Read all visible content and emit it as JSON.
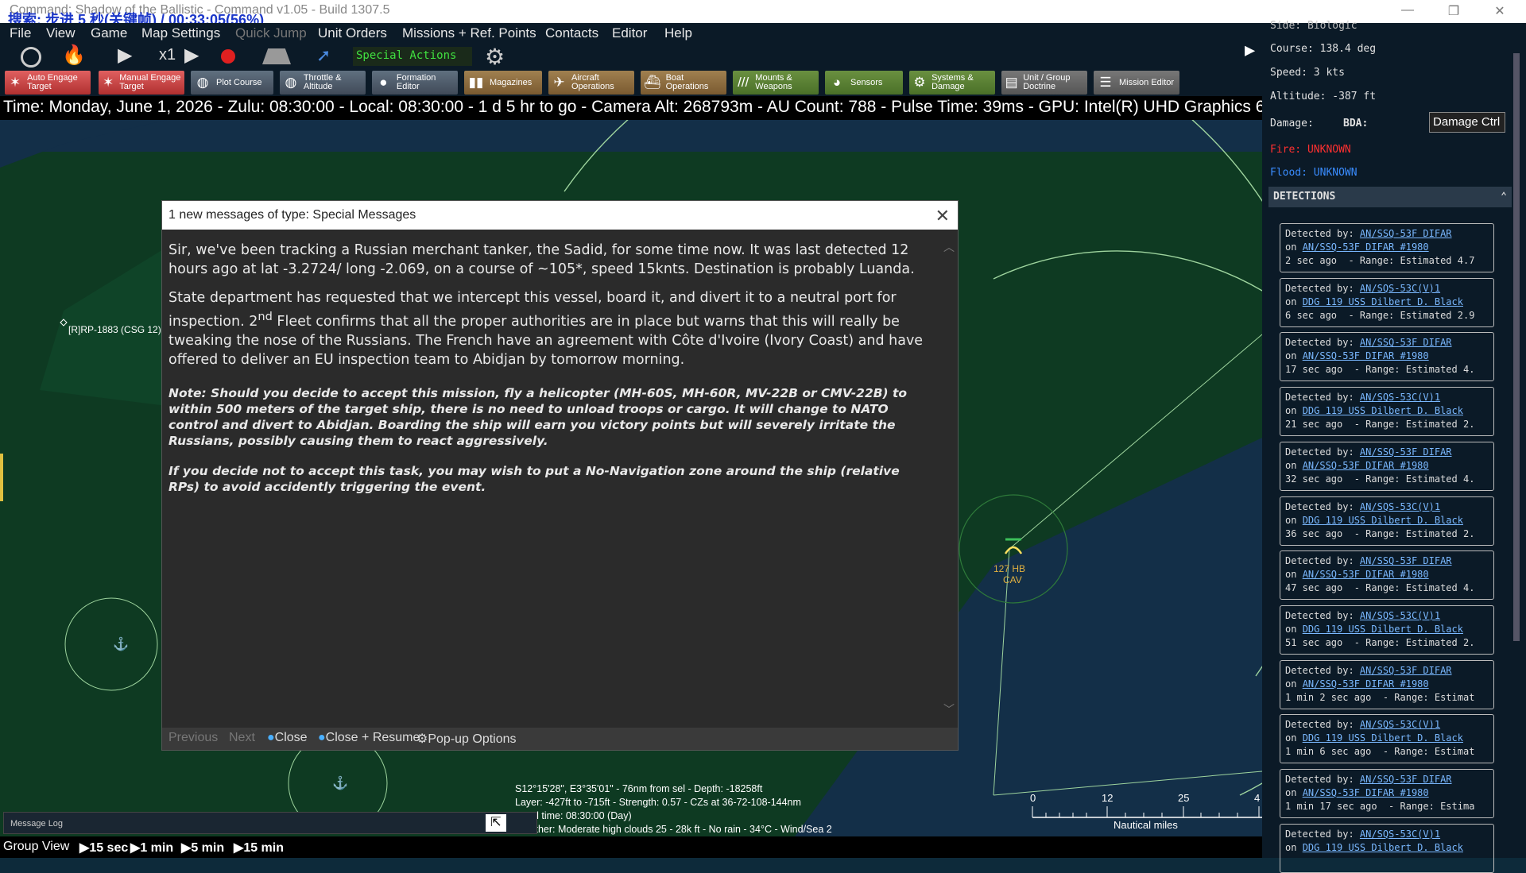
{
  "window": {
    "title": "Command: Shadow of the Ballistic - Command v1.05 - Build 1307.5",
    "overlay": "搜索: 步进 5 秒(关键帧) / 00:33:05(56%)",
    "minimize": "—",
    "restore": "❐",
    "close": "✕"
  },
  "menu": [
    "File",
    "View",
    "Game",
    "Map Settings",
    "Quick Jump",
    "Unit Orders",
    "Missions + Ref. Points",
    "Contacts",
    "Editor",
    "Help"
  ],
  "toolbar1": {
    "speed": "x1",
    "special_actions": "Special Actions"
  },
  "toolbar2": [
    "Auto Engage Target",
    "Manual Engage Target",
    "Plot Course",
    "Throttle & Altitude",
    "Formation Editor",
    "Magazines",
    "Aircraft Operations",
    "Boat Operations",
    "Mounts & Weapons",
    "Sensors",
    "Systems & Damage",
    "Unit / Group Doctrine",
    "Mission Editor"
  ],
  "status": "Time: Monday, June 1, 2026 - Zulu: 08:30:00 - Local: 08:30:00 - 1 d 5 hr to go -  Camera Alt: 268793m  - AU Count: 788 - Pulse Time: 39ms - GPU: Intel(R) UHD Graphics 630",
  "map": {
    "rp_label": "[R]RP-1883 (CSG 12)",
    "unit_label1": "127 HB",
    "unit_label2": "CAV"
  },
  "dialog": {
    "title": "1 new messages of type: Special Messages",
    "p1": "Sir, we've been tracking a Russian merchant tanker, the Sadid, for some time now. It was last detected 12 hours ago at lat -3.2724/ long -2.069, on a course of ~105*, speed 15knts. Destination is probably Luanda.",
    "p2a": "State department has requested that we intercept this vessel, board it, and divert it to a neutral port for inspection. 2",
    "p2sup": "nd",
    "p2b": " Fleet confirms that all the proper authorities are in place but warns that this will really be tweaking the nose of the Russians.  The French have an agreement with Côte d'Ivoire (Ivory Coast) and have offered to deliver an EU inspection team to Abidjan by tomorrow morning.",
    "note1": "Note: Should you decide to accept this mission, fly a helicopter (MH-60S, MH-60R, MV-22B or CMV-22B) to within 500 meters of the target ship, there is no need to unload troops or cargo. It will change to NATO control and divert to Abidjan. Boarding the ship will earn you victory points but will severely irritate the Russians, possibly causing them to react aggressively.",
    "note2": "If you decide not to accept this task, you may wish to put a No-Navigation zone around the ship (relative RPs) to avoid accidently triggering the event.",
    "previous": "Previous",
    "next": "Next",
    "close": "Close",
    "close_resume": "Close + Resume",
    "popup": "Pop-up Options"
  },
  "side": {
    "side": "Side: Biologic",
    "course": "Course: 138.4 deg",
    "speed": "Speed: 3 kts",
    "altitude": "Altitude: -387 ft",
    "damage": "Damage:",
    "bda": "BDA:",
    "damage_btn": "Damage Ctrl",
    "fire": "Fire: UNKNOWN",
    "flood": "Flood: UNKNOWN",
    "detections": "DETECTIONS",
    "items": [
      {
        "by": "AN/SSQ-53F DIFAR",
        "on": "AN/SSQ-53F DIFAR #1980",
        "ago": "2 sec ago",
        "range": "- Range: Estimated 4.7"
      },
      {
        "by": "AN/SQS-53C(V)1",
        "on": "DDG 119 USS Dilbert D. Black",
        "ago": "6 sec ago",
        "range": "- Range: Estimated 2.9"
      },
      {
        "by": "AN/SSQ-53F DIFAR",
        "on": "AN/SSQ-53F DIFAR #1980",
        "ago": "17 sec ago",
        "range": "- Range: Estimated 4."
      },
      {
        "by": "AN/SQS-53C(V)1",
        "on": "DDG 119 USS Dilbert D. Black",
        "ago": "21 sec ago",
        "range": "- Range: Estimated 2."
      },
      {
        "by": "AN/SSQ-53F DIFAR",
        "on": "AN/SSQ-53F DIFAR #1980",
        "ago": "32 sec ago",
        "range": "- Range: Estimated 4."
      },
      {
        "by": "AN/SQS-53C(V)1",
        "on": "DDG 119 USS Dilbert D. Black",
        "ago": "36 sec ago",
        "range": "- Range: Estimated 2."
      },
      {
        "by": "AN/SSQ-53F DIFAR",
        "on": "AN/SSQ-53F DIFAR #1980",
        "ago": "47 sec ago",
        "range": "- Range: Estimated 4."
      },
      {
        "by": "AN/SQS-53C(V)1",
        "on": "DDG 119 USS Dilbert D. Black",
        "ago": "51 sec ago",
        "range": "- Range: Estimated 2."
      },
      {
        "by": "AN/SSQ-53F DIFAR",
        "on": "AN/SSQ-53F DIFAR #1980",
        "ago": "1 min 2 sec ago",
        "range": "- Range: Estimat"
      },
      {
        "by": "AN/SQS-53C(V)1",
        "on": "DDG 119 USS Dilbert D. Black",
        "ago": "1 min 6 sec ago",
        "range": "- Range: Estimat"
      },
      {
        "by": "AN/SSQ-53F DIFAR",
        "on": "AN/SSQ-53F DIFAR #1980",
        "ago": "1 min 17 sec ago",
        "range": "- Range: Estima"
      },
      {
        "by": "AN/SQS-53C(V)1",
        "on": "DDG 119 USS Dilbert D. Black",
        "ago": "",
        "range": ""
      }
    ]
  },
  "info": {
    "l1": "S12°15'28\", E3°35'01\" - 76nm from sel - Depth: -18258ft",
    "l2": "Layer: -427ft to -715ft - Strength: 0.57 - CZs at 36-72-108-144nm",
    "l3": "Local time: 08:30:00 (Day)",
    "l4": "Weather: Moderate high clouds 25 - 28k ft - No rain - 34°C - Wind/Sea 2"
  },
  "scale": {
    "t0": "0",
    "t1": "12",
    "t2": "25",
    "t3": "4",
    "unit": "Nautical miles"
  },
  "bottom": {
    "group_view": "Group View",
    "b1": "15 sec",
    "b2": "1 min",
    "b3": "5 min",
    "b4": "15 min",
    "msglog": "Message Log"
  },
  "colors": {
    "map_bg": "#132f48",
    "land": "#0e3a22",
    "dialog_bg": "#2b2b2b",
    "fire": "#ff3030",
    "flood": "#3a8cff"
  }
}
